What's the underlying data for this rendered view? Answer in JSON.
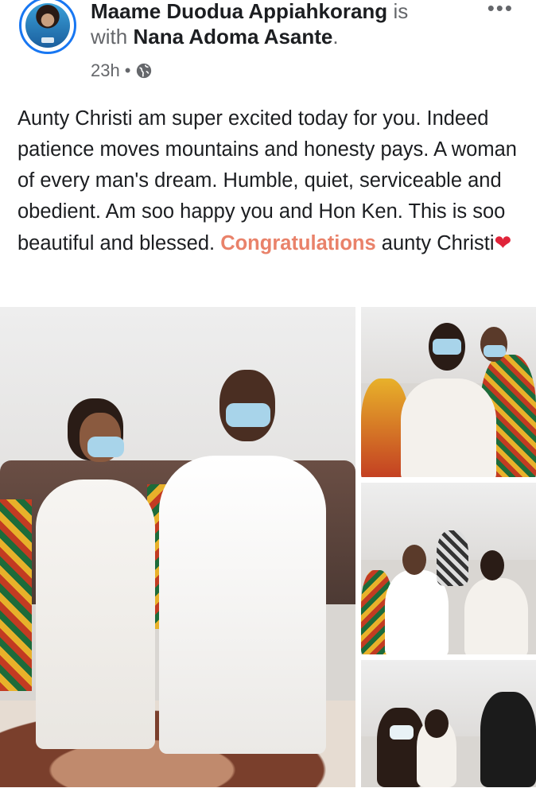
{
  "post": {
    "author": "Maame Duodua Appiahkorang",
    "is_word": "is",
    "with_word": "with",
    "tagged": "Nana Adoma Asante",
    "period": ".",
    "time": "23h",
    "dot": "•",
    "more_icon": "•••",
    "text_main": "Aunty Christi am super excited today for you. Indeed patience moves mountains and honesty pays. A woman of every man's dream.  Humble, quiet, serviceable and obedient.  Am soo happy you and Hon Ken. This is soo beautiful and blessed. ",
    "hashtag": "Congratulations",
    "text_end": " aunty Christi",
    "heart": "❤"
  },
  "colors": {
    "accent": "#1877f2",
    "hashtag": "#e9826a",
    "heart": "#e0243a",
    "muted": "#65676b"
  },
  "icons": {
    "globe": "globe-icon",
    "more": "more-options-icon"
  }
}
